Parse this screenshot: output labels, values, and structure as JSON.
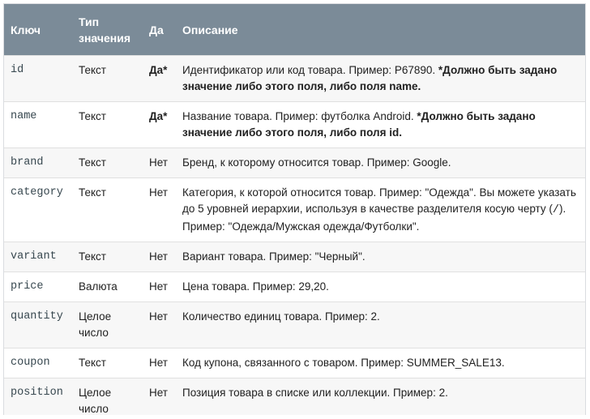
{
  "header": {
    "key": "Ключ",
    "type": "Тип значения",
    "required": "Да",
    "description": "Описание"
  },
  "rows": [
    {
      "key": "id",
      "type": "Текст",
      "required": "Да*",
      "desc": "Идентификатор или код товара. Пример: P67890. ",
      "note": "*Должно быть задано значение либо этого поля, либо поля name."
    },
    {
      "key": "name",
      "type": "Текст",
      "required": "Да*",
      "desc": "Название товара. Пример: футболка Android. ",
      "note": "*Должно быть задано значение либо этого поля, либо поля id."
    },
    {
      "key": "brand",
      "type": "Текст",
      "required": "Нет",
      "desc": "Бренд, к которому относится товар. Пример: Google."
    },
    {
      "key": "category",
      "type": "Текст",
      "required": "Нет",
      "desc": "Категория, к которой относится товар. Пример: \"Одежда\". Вы можете указать до 5 уровней иерархии, используя в качестве разделителя косую черту (",
      "desc_code": "/",
      "desc_tail": "). Пример: \"Одежда/Мужская одежда/Футболки\"."
    },
    {
      "key": "variant",
      "type": "Текст",
      "required": "Нет",
      "desc": "Вариант товара. Пример: \"Черный\"."
    },
    {
      "key": "price",
      "type": "Валюта",
      "required": "Нет",
      "desc": "Цена товара. Пример: 29,20."
    },
    {
      "key": "quantity",
      "type": "Целое число",
      "required": "Нет",
      "desc": "Количество единиц товара. Пример: 2."
    },
    {
      "key": "coupon",
      "type": "Текст",
      "required": "Нет",
      "desc": "Код купона, связанного с товаром. Пример: SUMMER_SALE13."
    },
    {
      "key": "position",
      "type": "Целое число",
      "required": "Нет",
      "desc": "Позиция товара в списке или коллекции. Пример: 2."
    }
  ]
}
